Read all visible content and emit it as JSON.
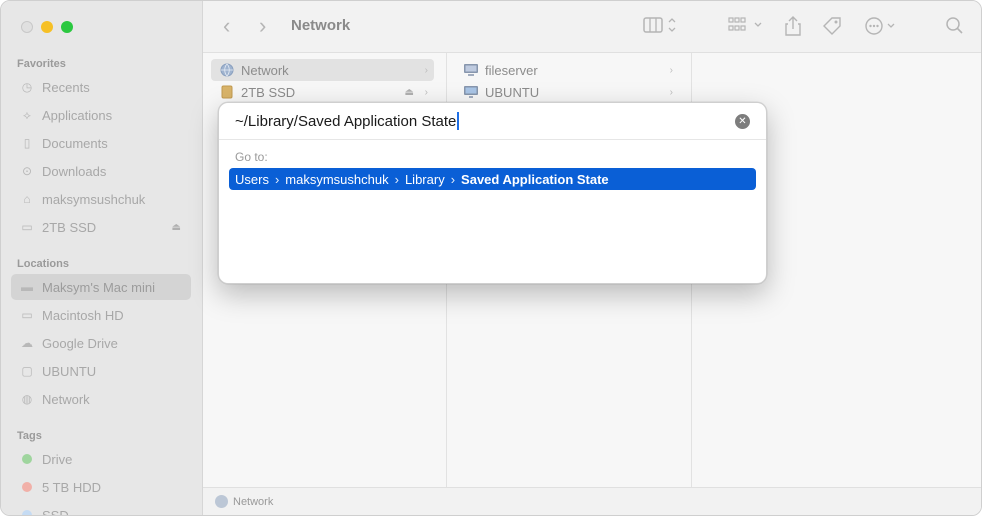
{
  "sidebar": {
    "favorites_heading": "Favorites",
    "favorites": [
      {
        "label": "Recents",
        "icon": "clock-icon"
      },
      {
        "label": "Applications",
        "icon": "applications-icon"
      },
      {
        "label": "Documents",
        "icon": "document-icon"
      },
      {
        "label": "Downloads",
        "icon": "download-icon"
      },
      {
        "label": "maksymsushchuk",
        "icon": "home-icon"
      },
      {
        "label": "2TB SSD",
        "icon": "drive-icon"
      }
    ],
    "locations_heading": "Locations",
    "locations": [
      {
        "label": "Maksym's Mac mini",
        "icon": "computer-icon"
      },
      {
        "label": "Macintosh HD",
        "icon": "drive-icon"
      },
      {
        "label": "Google Drive",
        "icon": "cloud-icon"
      },
      {
        "label": "UBUNTU",
        "icon": "display-icon"
      },
      {
        "label": "Network",
        "icon": "globe-icon"
      }
    ],
    "tags_heading": "Tags",
    "tags": [
      {
        "label": "Drive",
        "color": "#5cc25b"
      },
      {
        "label": "5 TB HDD",
        "color": "#f07a6e"
      },
      {
        "label": "SSD",
        "color": "#9ec4ef"
      }
    ]
  },
  "toolbar": {
    "title": "Network"
  },
  "column1": [
    {
      "label": "Network",
      "icon": "globe-icon"
    },
    {
      "label": "2TB SSD",
      "icon": "drive-icon"
    }
  ],
  "column2": [
    {
      "label": "fileserver",
      "icon": "server-icon"
    },
    {
      "label": "UBUNTU",
      "icon": "display-icon"
    }
  ],
  "statusbar": {
    "label": "Network"
  },
  "goto_dialog": {
    "input_value": "~/Library/Saved Application State",
    "goto_label": "Go to:",
    "suggestion": [
      "Users",
      "maksymsushchuk",
      "Library",
      "Saved Application State"
    ]
  },
  "colors": {
    "accent": "#0a5fd6",
    "close": "#e0e0e0",
    "minimize": "#f6c026",
    "maximize": "#2bc840"
  }
}
